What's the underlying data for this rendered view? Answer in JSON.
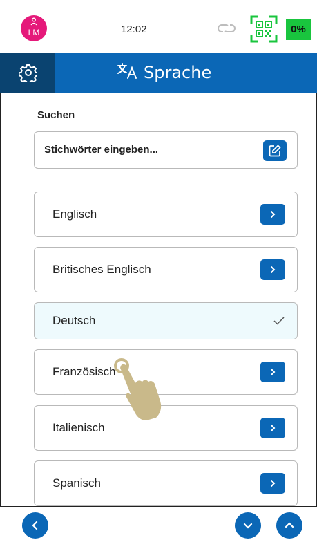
{
  "status": {
    "avatar_initials": "LM",
    "time": "12:02",
    "battery": "0%",
    "colors": {
      "avatar": "#e5197a",
      "battery": "#19c53e",
      "qr": "#19c53e"
    }
  },
  "header": {
    "title": "Sprache",
    "colors": {
      "bar": "#0b67b6",
      "settings_box": "#0a4370"
    }
  },
  "search": {
    "label": "Suchen",
    "placeholder": "Stichwörter eingeben..."
  },
  "languages": [
    {
      "label": "Englisch",
      "selected": false
    },
    {
      "label": "Britisches Englisch",
      "selected": false
    },
    {
      "label": "Deutsch",
      "selected": true
    },
    {
      "label": "Französisch",
      "selected": false
    },
    {
      "label": "Italienisch",
      "selected": false
    },
    {
      "label": "Spanisch",
      "selected": false
    }
  ],
  "icons": {
    "settings": "gear-icon",
    "translate": "translate-icon",
    "edit": "edit-icon",
    "chevron_right": "chevron-right-icon",
    "check": "check-icon",
    "back": "chevron-left-icon",
    "scroll_down": "chevron-down-icon",
    "scroll_up": "chevron-up-icon"
  }
}
